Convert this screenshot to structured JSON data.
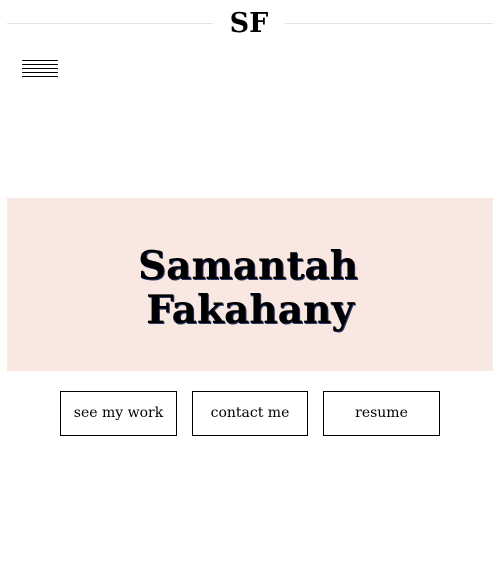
{
  "header": {
    "logo_text": "SF"
  },
  "nav": {
    "menu_icon": "hamburger-menu-icon"
  },
  "hero": {
    "name_first": "Samantah",
    "name_last": "Fakahany",
    "background_color": "#f9e8e2"
  },
  "actions": {
    "work_label": "see my work",
    "contact_label": "contact me",
    "resume_label": "resume"
  }
}
